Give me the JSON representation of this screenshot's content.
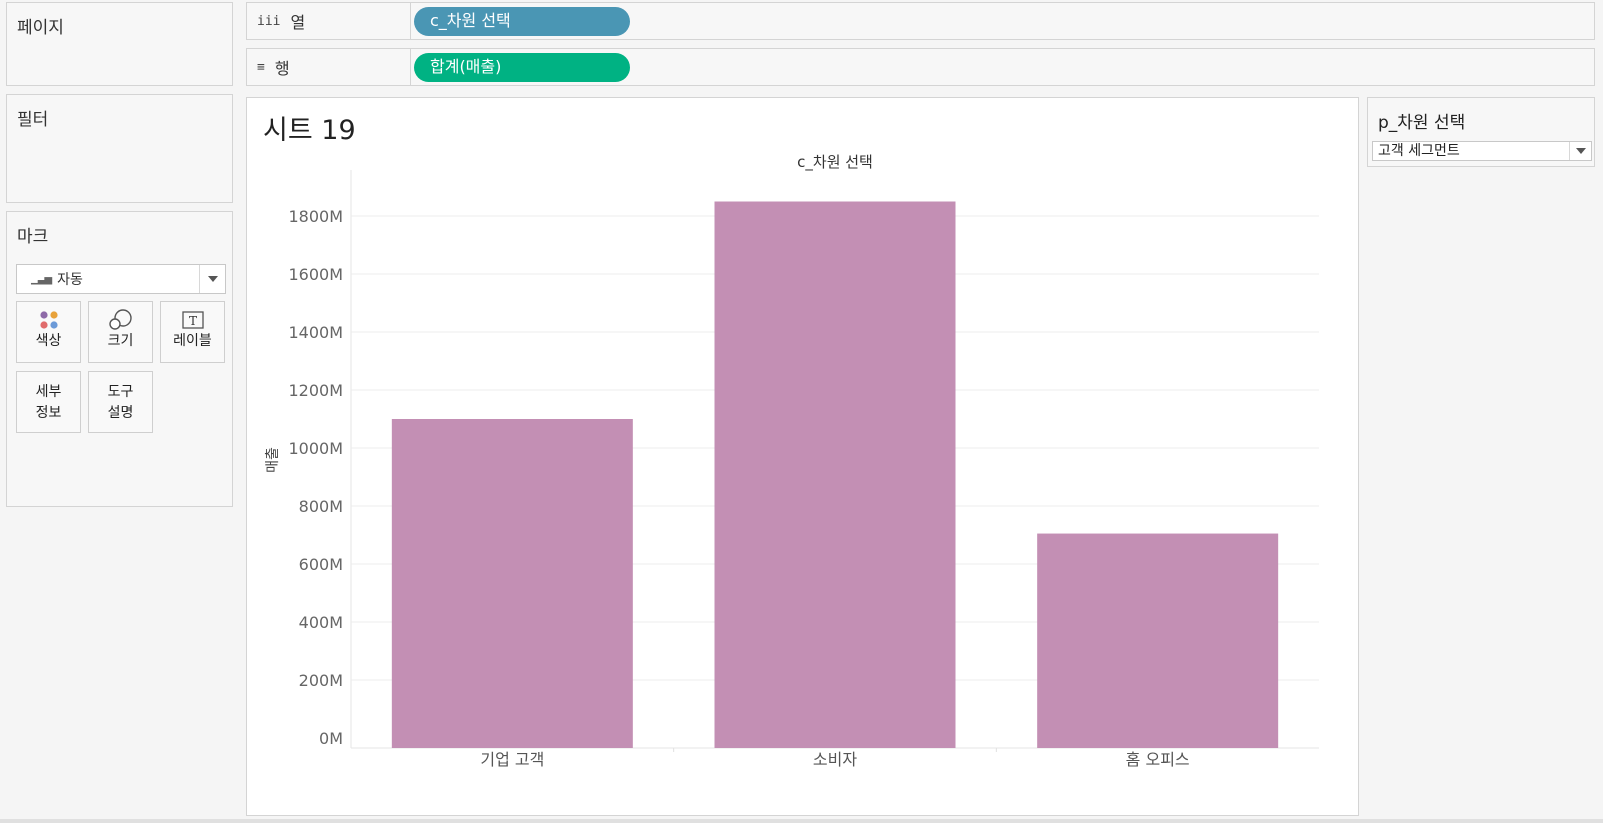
{
  "left_panels": {
    "pages_title": "페이지",
    "filters_title": "필터",
    "marks_title": "마크"
  },
  "shelves": {
    "columns": {
      "icon": "iii",
      "label": "열",
      "pill": "c_차원 선택"
    },
    "rows": {
      "icon": "≡",
      "label": "행",
      "pill": "합계(매출)"
    }
  },
  "marks": {
    "type_label": "자동",
    "buttons": {
      "color": "색상",
      "size": "크기",
      "label": "레이블",
      "detail_1": "세부",
      "detail_2": "정보",
      "tooltip_1": "도구",
      "tooltip_2": "설명"
    }
  },
  "sheet": {
    "title": "시트 19"
  },
  "parameter": {
    "title": "p_차원 선택",
    "selected": "고객 세그먼트"
  },
  "colors": {
    "bar": "#c38fb4",
    "pill_dimension": "#4a96b4",
    "pill_measure": "#00b283"
  },
  "chart_data": {
    "type": "bar",
    "title": "c_차원 선택",
    "ylabel": "매출",
    "categories": [
      "기업 고객",
      "소비자",
      "홈 오피스"
    ],
    "values": [
      1100,
      1850,
      705
    ],
    "y_ticks": [
      "0M",
      "200M",
      "400M",
      "600M",
      "800M",
      "1000M",
      "1200M",
      "1400M",
      "1600M",
      "1800M"
    ],
    "ylim": [
      0,
      1800
    ],
    "grid": true
  }
}
